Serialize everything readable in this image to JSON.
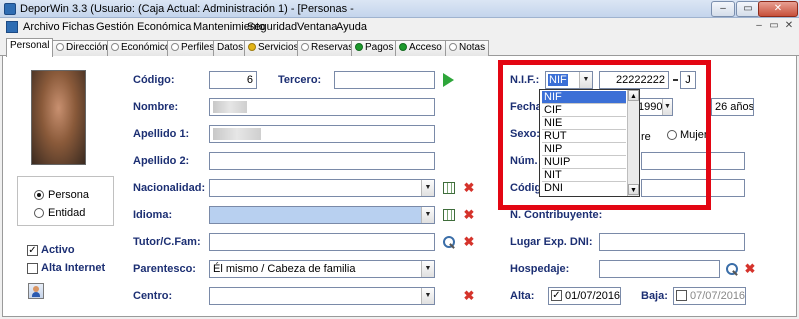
{
  "window": {
    "title": "DeporWin 3.3  (Usuario:            (Caja Actual: Administración 1) - [Personas -",
    "min": "‒",
    "restore": "▭",
    "close": "✕"
  },
  "menu": {
    "items": [
      "Archivo",
      "Fichas",
      "Gestión Económica",
      "Mantenimiento",
      "Seguridad",
      "Ventana",
      "Ayuda"
    ],
    "mini": [
      "‒",
      "▭",
      "✕"
    ]
  },
  "tabs": [
    {
      "label": "Personal"
    },
    {
      "label": "Dirección"
    },
    {
      "label": "Económico"
    },
    {
      "label": "Perfiles"
    },
    {
      "label": "Datos"
    },
    {
      "label": "Servicios"
    },
    {
      "label": "Reservas"
    },
    {
      "label": "Pagos"
    },
    {
      "label": "Acceso"
    },
    {
      "label": "Notas"
    }
  ],
  "form": {
    "codigo_label": "Código:",
    "codigo_value": "6",
    "tercero_label": "Tercero:",
    "nombre_label": "Nombre:",
    "apellido1_label": "Apellido 1:",
    "apellido2_label": "Apellido 2:",
    "nacionalidad_label": "Nacionalidad:",
    "idioma_label": "Idioma:",
    "tutor_label": "Tutor/C.Fam:",
    "parentesco_label": "Parentesco:",
    "parentesco_value": "Él mismo / Cabeza de familia",
    "centro_label": "Centro:",
    "persona_label": "Persona",
    "entidad_label": "Entidad",
    "activo_label": "Activo",
    "alta_internet_label": "Alta Internet",
    "nif_label": "N.I.F.:",
    "nif_type": "NIF",
    "nif_value": "22222222",
    "nif_letter": "J",
    "fecha_label": "Fecha",
    "fecha_year": "1990",
    "edad_value": "26 años",
    "sexo_label": "Sexo:",
    "hombre_partial": "re",
    "mujer_label": "Mujer",
    "num_label": "Núm. S",
    "codigo2_label": "Código",
    "n_contribuyente_label": "N. Contribuyente:",
    "lugar_label": "Lugar Exp. DNI:",
    "hospedaje_label": "Hospedaje:",
    "alta_label": "Alta:",
    "alta_value": "01/07/2016",
    "baja_label": "Baja:",
    "baja_value": "07/07/2016"
  },
  "nif_options": [
    "NIF",
    "CIF",
    "NIE",
    "RUT",
    "NIP",
    "NUIP",
    "NIT",
    "DNI"
  ],
  "icons": {
    "delete": "✖",
    "check": "✓",
    "arrow_down": "▼",
    "arrow_up": "▲"
  },
  "colors": {
    "highlight": "#e30613",
    "label": "#1c2f73",
    "selected": "#3b6fd6"
  }
}
